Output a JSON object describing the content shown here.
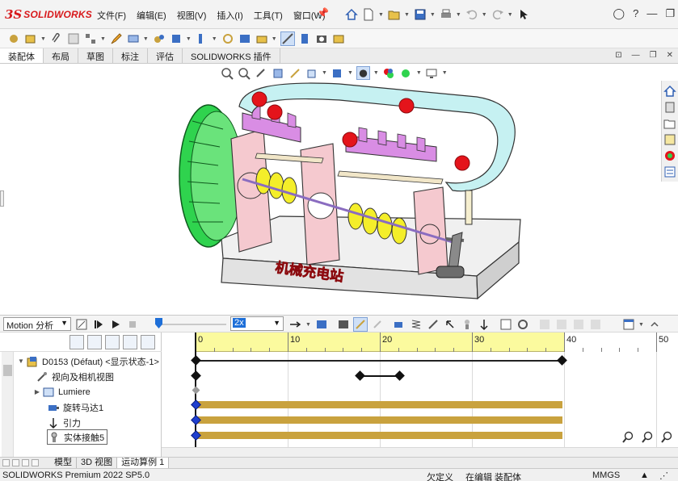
{
  "app": {
    "brand": "SOLIDWORKS",
    "brand_prefix": "3S"
  },
  "menu": {
    "items": [
      "文件(F)",
      "编辑(E)",
      "视图(V)",
      "插入(I)",
      "工具(T)",
      "窗口(W)"
    ]
  },
  "command_tabs": [
    "装配体",
    "布局",
    "草图",
    "标注",
    "评估",
    "SOLIDWORKS 插件"
  ],
  "model_label": "机械充电站",
  "motion": {
    "study_type": "Motion 分析",
    "playback_speed": "2x",
    "timeline_labels": [
      "0",
      "10",
      "20",
      "30",
      "40",
      "50"
    ],
    "tree": [
      {
        "label": "D0153 (Défaut) <显示状态-1>",
        "icon": "assembly-icon"
      },
      {
        "label": "视向及相机视图",
        "icon": "camera-icon"
      },
      {
        "label": "Lumiere",
        "icon": "light-icon"
      },
      {
        "label": "旋转马达1",
        "icon": "motor-icon"
      },
      {
        "label": "引力",
        "icon": "gravity-icon"
      },
      {
        "label": "实体接触5",
        "icon": "contact-icon"
      }
    ]
  },
  "bottom_tabs": [
    "模型",
    "3D 视图",
    "运动算例 1"
  ],
  "status": {
    "product": "SOLIDWORKS Premium 2022 SP5.0",
    "constraint": "欠定义",
    "mode": "在编辑 装配体",
    "units": "MMGS"
  },
  "colors": {
    "brand_red": "#d8191c",
    "keyframe_blue": "#1f3fd0",
    "timeline_yellow": "#fbfa9e",
    "track_gold": "#c9a23e",
    "gear_green": "#2fd34e",
    "frame_pink": "#f5c9cf",
    "ball_red": "#e4141b",
    "cam_yellow": "#f4ee2a",
    "rail_cyan": "#c6f1f2"
  }
}
